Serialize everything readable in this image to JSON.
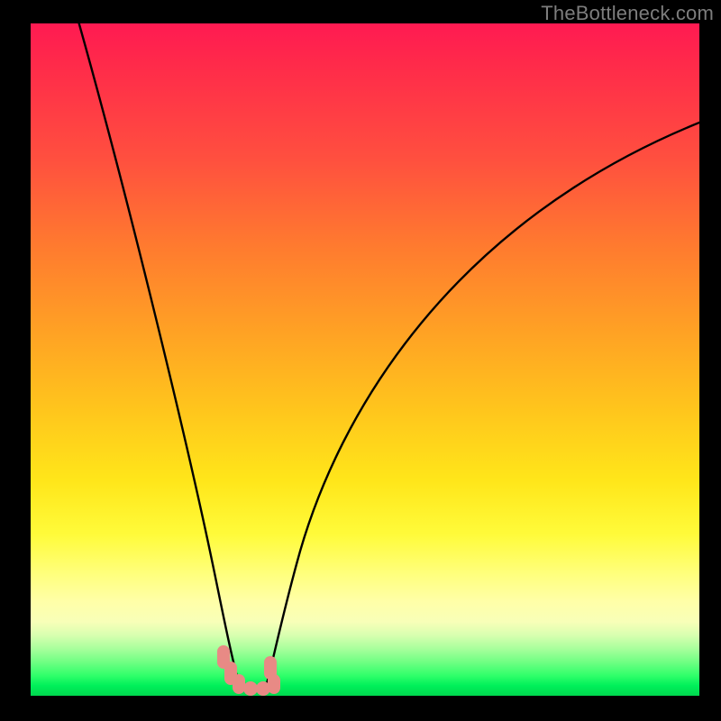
{
  "watermark": "TheBottleneck.com",
  "colors": {
    "background": "#000000",
    "curve": "#000000",
    "marker": "#e88a85",
    "gradient_top": "#ff1a52",
    "gradient_bottom": "#00d84f"
  },
  "chart_data": {
    "type": "line",
    "title": "",
    "xlabel": "",
    "ylabel": "",
    "xlim": [
      0,
      100
    ],
    "ylim": [
      0,
      100
    ],
    "grid": false,
    "legend": false,
    "series": [
      {
        "name": "left-branch",
        "x": [
          7,
          10,
          13,
          16,
          19,
          22,
          24.5,
          26,
          27.2,
          28.2,
          29,
          29.6,
          30.2,
          30.7,
          31.2
        ],
        "y": [
          100,
          85,
          70,
          55,
          41,
          28,
          17,
          10,
          6,
          3.5,
          2,
          1.2,
          0.7,
          0.4,
          0.2
        ]
      },
      {
        "name": "right-branch",
        "x": [
          35.2,
          35.8,
          37,
          39,
          42,
          46,
          51,
          57,
          64,
          72,
          80,
          88,
          95,
          100
        ],
        "y": [
          0.2,
          1.2,
          4,
          10,
          19,
          30,
          41,
          52,
          61,
          69,
          75,
          80,
          83,
          85
        ]
      }
    ],
    "flat_segment": {
      "x_start": 31.2,
      "x_end": 35.2,
      "y": 0
    },
    "markers": {
      "name": "highlight-cluster",
      "x": [
        28.6,
        29.6,
        30.6,
        31.6,
        32.6,
        33.6,
        34.6,
        35.4,
        36.0
      ],
      "y": [
        4.0,
        2.2,
        1.2,
        0.7,
        0.5,
        0.5,
        0.7,
        1.3,
        3.2
      ]
    }
  }
}
